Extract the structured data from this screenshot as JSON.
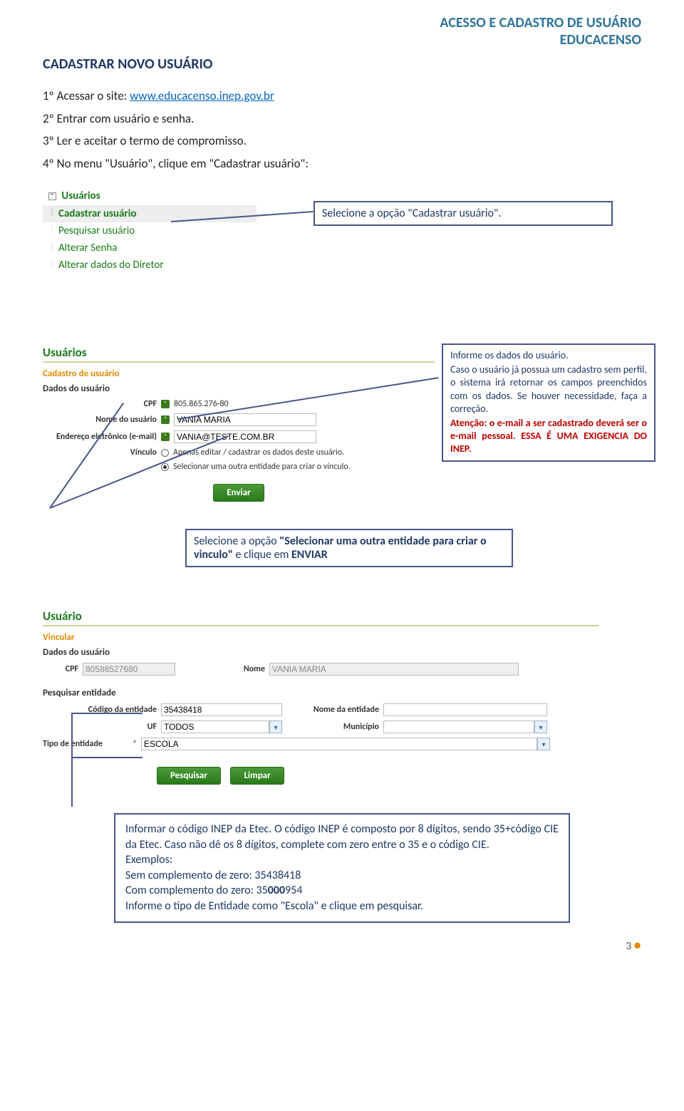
{
  "header": {
    "line1": "ACESSO E CADASTRO DE USUÁRIO",
    "line2": "EDUCACENSO"
  },
  "section_title": "CADASTRAR NOVO USUÁRIO",
  "steps": {
    "s1_pre": "1º Acessar o site: ",
    "s1_link": "www.educacenso.inep.gov.br",
    "s2": "2º Entrar com usuário e senha.",
    "s3": "3º Ler e aceitar o termo de compromisso.",
    "s4": "4º No menu \"Usuário\", clique em \"Cadastrar usuário\":"
  },
  "menu": {
    "head": "Usuários",
    "items": [
      "Cadastrar usuário",
      "Pesquisar usuário",
      "Alterar Senha",
      "Alterar dados do Diretor"
    ]
  },
  "callout1": "Selecione a opção \"Cadastrar usuário\".",
  "form1": {
    "h1": "Usuários",
    "h2": "Cadastro de usuário",
    "sec": "Dados do usuário",
    "cpf_lbl": "CPF",
    "cpf_val": "805.865.276-80",
    "nome_lbl": "Nome do usuário",
    "nome_val": "VANIA MARIA",
    "email_lbl": "Endereço eletrônico (e-mail)",
    "email_val": "VANIA@TESTE.COM.BR",
    "vinculo_lbl": "Vínculo",
    "r1": "Apenas editar / cadastrar os dados deste usuário.",
    "r2": "Selecionar uma outra entidade para criar o vínculo.",
    "btn": "Enviar"
  },
  "callout2a": "Informe os dados do usuário.",
  "callout2b": "Caso o usuário já possua um cadastro sem perfil, o sistema irá retornar os campos preenchidos com os dados. Se houver necessidade, faça a correção.",
  "callout2c_red": "Atenção: o e-mail a ser cadastrado deverá ser o e-mail pessoal. ESSA É UMA EXIGENCIA DO INEP.",
  "callout3_pre": "Selecione a opção ",
  "callout3_mid": "\"Selecionar uma outra entidade para criar o vinculo\"",
  "callout3_post": " e clique em ",
  "callout3_end": "ENVIAR",
  "form2": {
    "h1": "Usuário",
    "h2": "Vincular",
    "sec1": "Dados do usuário",
    "cpf_lbl": "CPF",
    "cpf_val": "80586527680",
    "nome_lbl": "Nome",
    "nome_val": "VANIA MARIA",
    "sec2": "Pesquisar entidade",
    "cod_lbl": "Código da entidade",
    "cod_val": "35438418",
    "nomee_lbl": "Nome da entidade",
    "uf_lbl": "UF",
    "uf_val": "TODOS",
    "mun_lbl": "Município",
    "tipo_lbl": "Tipo de entidade",
    "tipo_val": "ESCOLA",
    "btn1": "Pesquisar",
    "btn2": "Limpar"
  },
  "footer": "Informar o código INEP da Etec. O código INEP é composto por 8 dígitos, sendo 35+código CIE da Etec. Caso não dê os 8 dígitos, complete com zero entre o 35 e o código CIE.\nExemplos:\nSem complemento de zero: 35438418\nCom complemento do zero: 35000954\nInforme o tipo de Entidade como \"Escola\" e clique em pesquisar.",
  "page_number": "3"
}
